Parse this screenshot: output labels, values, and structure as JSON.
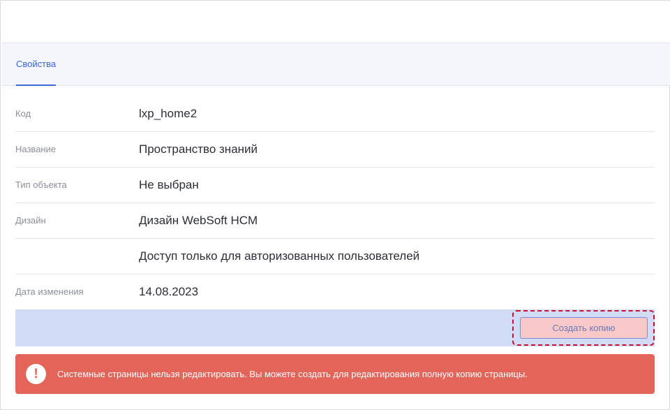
{
  "tabs": [
    {
      "label": "Свойства",
      "active": true
    }
  ],
  "properties": [
    {
      "label": "Код",
      "value": "lxp_home2"
    },
    {
      "label": "Название",
      "value": "Пространство знаний"
    },
    {
      "label": "Тип объекта",
      "value": "Не выбран"
    },
    {
      "label": "Дизайн",
      "value": "Дизайн WebSoft HCM"
    },
    {
      "label": "",
      "value": "Доступ только для авторизованных пользователей"
    },
    {
      "label": "Дата изменения",
      "value": "14.08.2023"
    }
  ],
  "actions": {
    "copy_label": "Создать копию"
  },
  "alert": {
    "icon": "exclamation-icon",
    "glyph": "!",
    "text": "Системные страницы нельзя редактировать. Вы можете создать для редактирования полную копию страницы."
  },
  "colors": {
    "accent": "#3a66d6",
    "alert_bg": "#e3655a",
    "actionbar_bg": "#d2dcf7",
    "copy_button_bg": "#f9c9c9",
    "highlight_outline": "#c8102e"
  }
}
